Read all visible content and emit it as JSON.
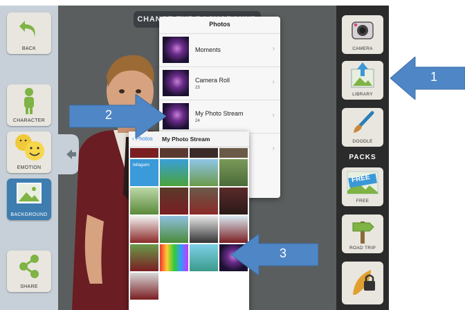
{
  "header": {
    "title": "CHANGE THE BACKGROUND"
  },
  "left_toolbar": {
    "back_label": "BACK",
    "character_label": "CHARACTER",
    "emotion_label": "EMOTION",
    "background_label": "BACKGROUND",
    "share_label": "SHARE"
  },
  "right_toolbar": {
    "camera_label": "CAMERA",
    "library_label": "LIBRARY",
    "doodle_label": "DOODLE",
    "packs_label": "PACKS",
    "free_label": "FREE",
    "free_badge": "FREE",
    "road_trip_label": "ROAD TRIP"
  },
  "photos_popover": {
    "title": "Photos",
    "albums": [
      {
        "name": "Moments",
        "count": ""
      },
      {
        "name": "Camera Roll",
        "count": "23"
      },
      {
        "name": "My Photo Stream",
        "count": "24"
      },
      {
        "name": "",
        "count": ""
      }
    ]
  },
  "stream_popover": {
    "back_label": "Photos",
    "title": "My Photo Stream",
    "tellagami_label": "tellagami"
  },
  "callouts": [
    {
      "number": "1"
    },
    {
      "number": "2"
    },
    {
      "number": "3"
    }
  ],
  "colors": {
    "accent_blue": "#4f86c6",
    "selected_tile": "#3d7db0",
    "stage": "#5b5e5e"
  }
}
